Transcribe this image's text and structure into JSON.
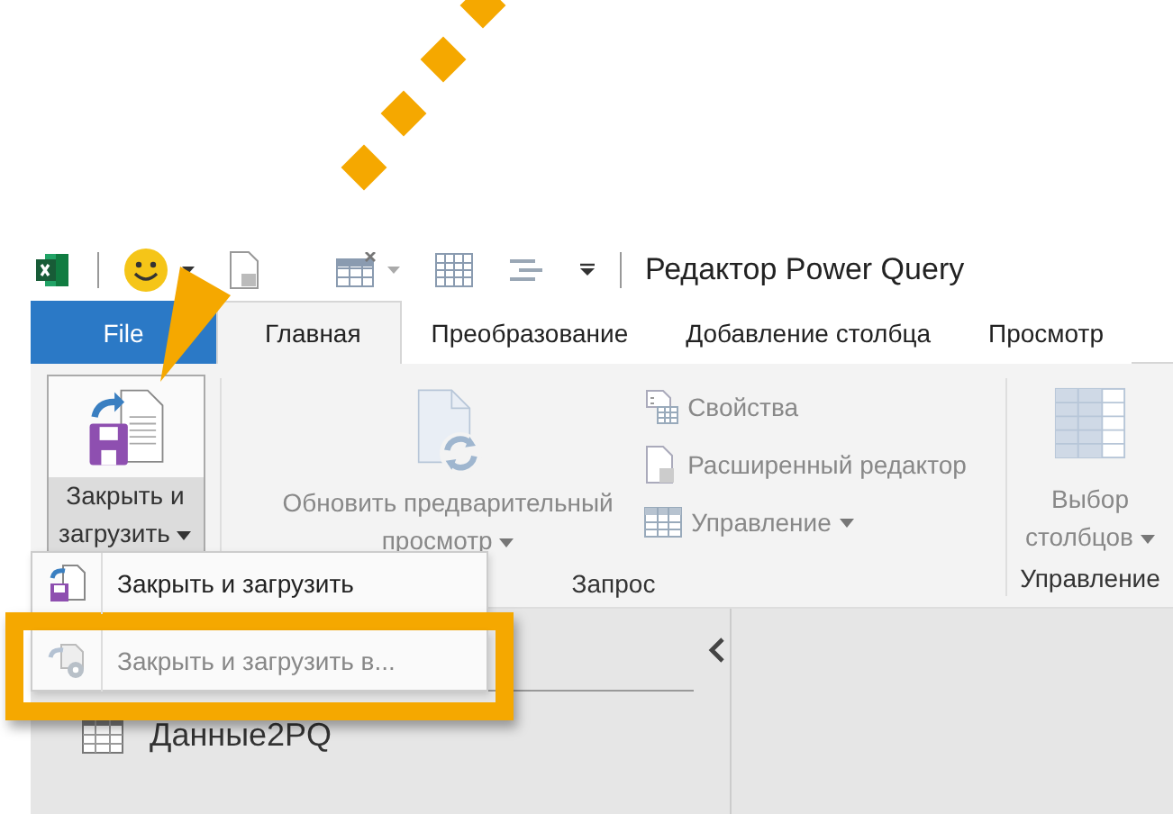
{
  "window": {
    "title": "Редактор Power Query"
  },
  "tabs": [
    {
      "label": "File",
      "kind": "file",
      "selected": false
    },
    {
      "label": "Главная",
      "kind": "tab",
      "selected": true
    },
    {
      "label": "Преобразование",
      "kind": "tab",
      "selected": false
    },
    {
      "label": "Добавление столбца",
      "kind": "tab",
      "selected": false
    },
    {
      "label": "Просмотр",
      "kind": "tab",
      "selected": false
    }
  ],
  "ribbon": {
    "close_group": {
      "button": {
        "label": "Закрыть и загрузить",
        "expanded": true
      }
    },
    "query_group": {
      "label": "Запрос",
      "refresh": {
        "label": "Обновить предварительный просмотр",
        "disabled": true
      },
      "items": [
        {
          "kind": "properties",
          "label": "Свойства",
          "disabled": true,
          "dropdown": false
        },
        {
          "kind": "editor",
          "label": "Расширенный редактор",
          "disabled": true,
          "dropdown": false
        },
        {
          "kind": "manage",
          "label": "Управление",
          "disabled": true,
          "dropdown": true
        }
      ]
    },
    "manage_group": {
      "label": "Управление",
      "button": {
        "label": "Выбор столбцов",
        "disabled": true
      }
    }
  },
  "dropdown_menu": [
    {
      "label": "Закрыть и загрузить",
      "disabled": false,
      "highlighted": false
    },
    {
      "label": "Закрыть и загрузить в...",
      "disabled": true,
      "highlighted": true
    }
  ],
  "queries_pane": {
    "items": [
      {
        "label": "Данные2PQ"
      }
    ]
  }
}
